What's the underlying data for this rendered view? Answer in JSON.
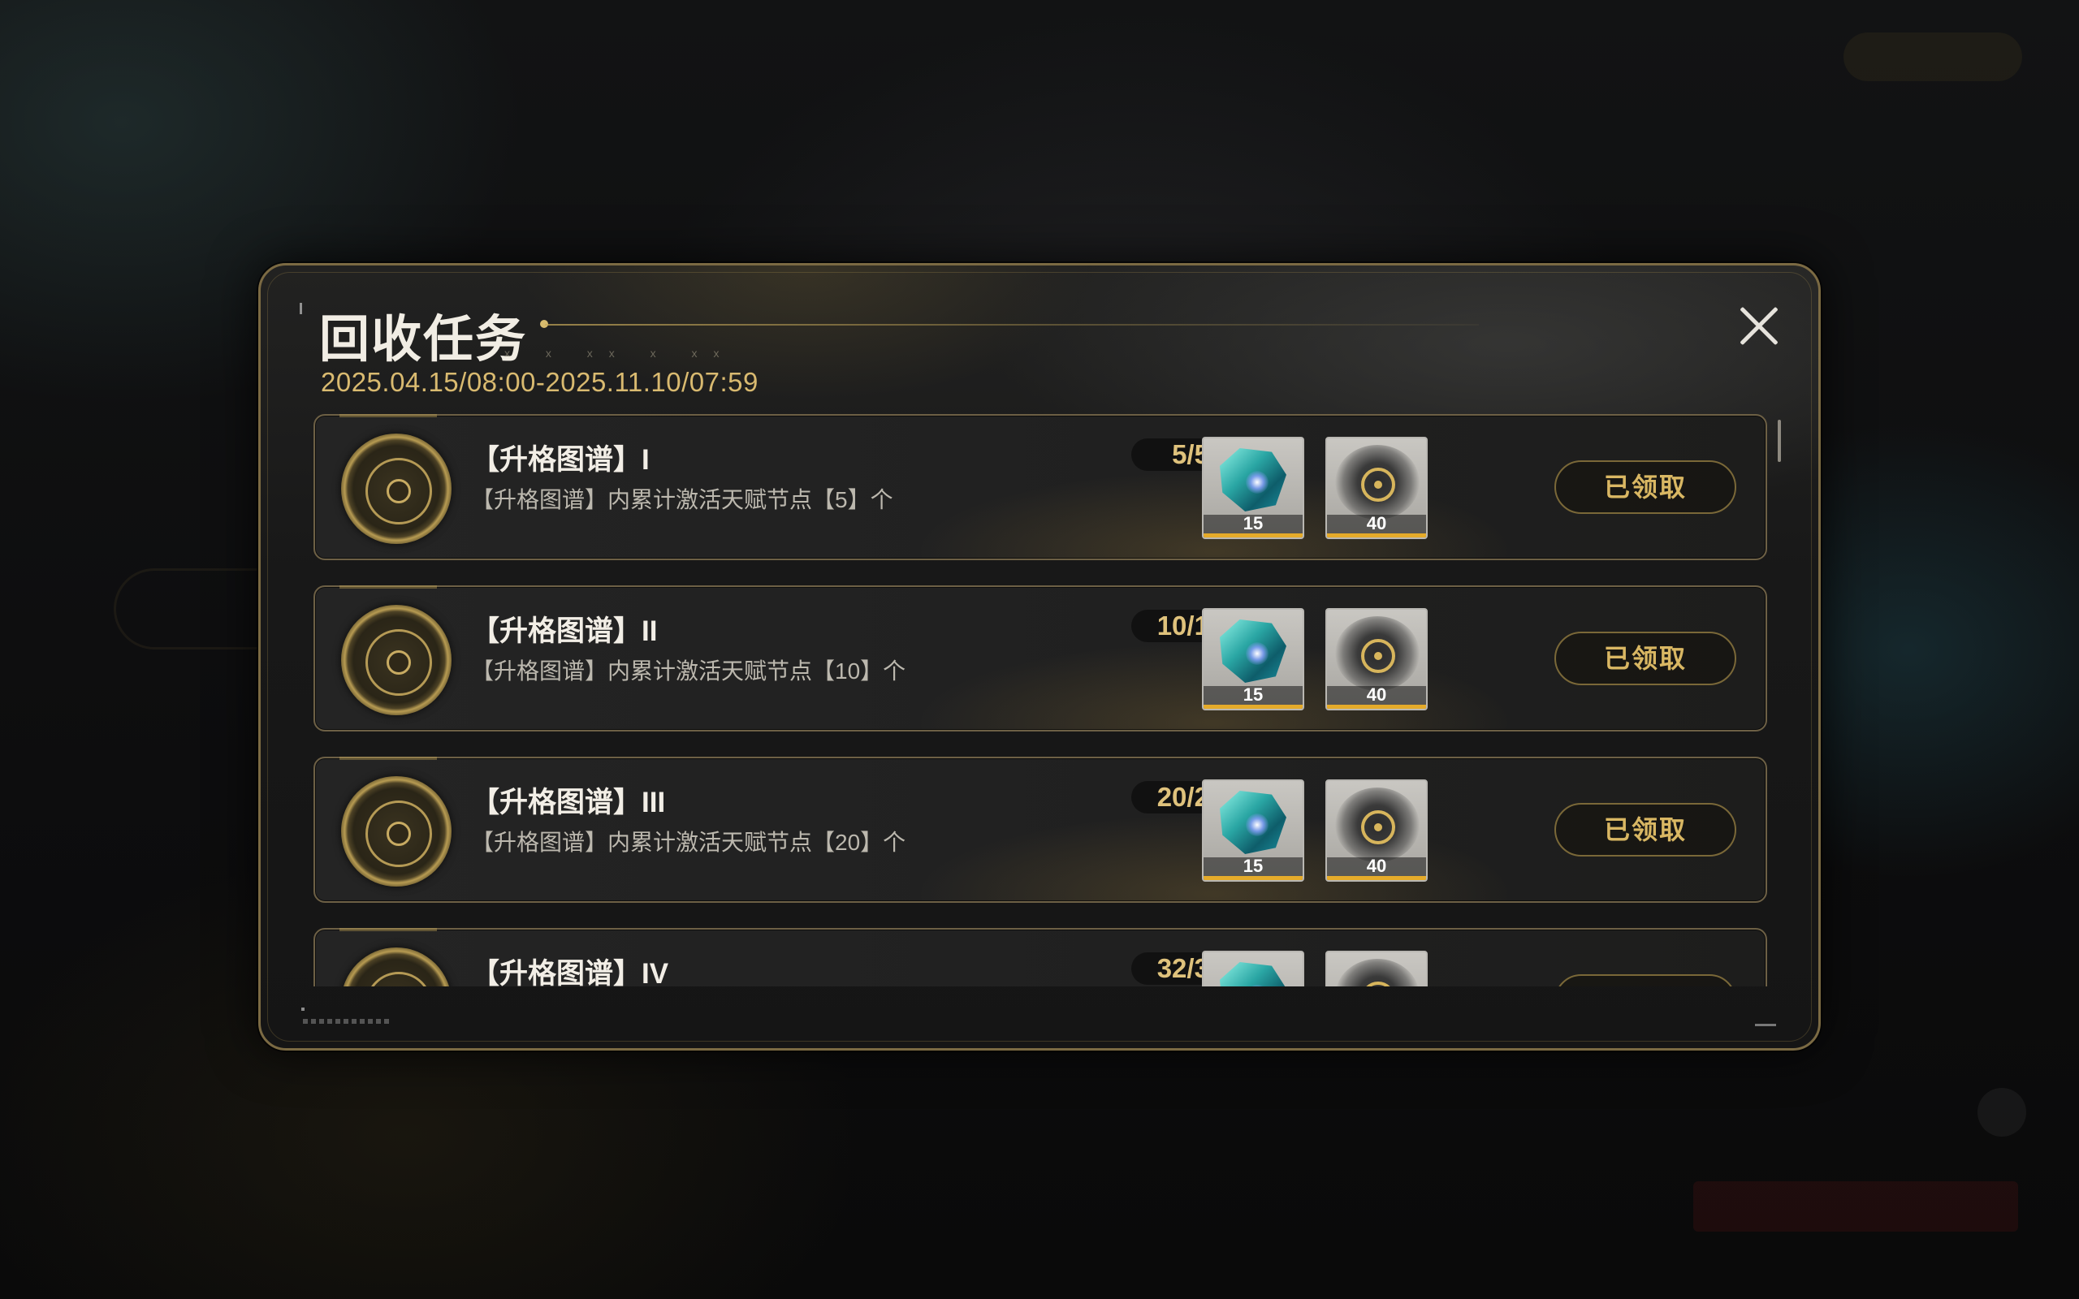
{
  "modal": {
    "title": "回收任务",
    "date_range": "2025.04.15/08:00-2025.11.10/07:59"
  },
  "icons": {
    "close": "close-icon",
    "task_emblem": "talent-chart-emblem-icon",
    "reward_1": "teal-crystal-icon",
    "reward_2": "gold-cog-icon"
  },
  "colors": {
    "accent_gold": "#d9b763",
    "progress_text": "#dfc27c",
    "quantity_bar": "#e5ab2a"
  },
  "tasks": [
    {
      "title": "【升格图谱】I",
      "description": "【升格图谱】内累计激活天赋节点【5】个",
      "progress": "5/5",
      "rewards": [
        {
          "icon": "teal-crystal-icon",
          "quantity": "15"
        },
        {
          "icon": "gold-cog-icon",
          "quantity": "40"
        }
      ],
      "status_label": "已领取"
    },
    {
      "title": "【升格图谱】II",
      "description": "【升格图谱】内累计激活天赋节点【10】个",
      "progress": "10/10",
      "rewards": [
        {
          "icon": "teal-crystal-icon",
          "quantity": "15"
        },
        {
          "icon": "gold-cog-icon",
          "quantity": "40"
        }
      ],
      "status_label": "已领取"
    },
    {
      "title": "【升格图谱】III",
      "description": "【升格图谱】内累计激活天赋节点【20】个",
      "progress": "20/20",
      "rewards": [
        {
          "icon": "teal-crystal-icon",
          "quantity": "15"
        },
        {
          "icon": "gold-cog-icon",
          "quantity": "40"
        }
      ],
      "status_label": "已领取"
    },
    {
      "title": "【升格图谱】IV",
      "description": "",
      "progress": "32/32",
      "rewards": [
        {
          "icon": "teal-crystal-icon",
          "quantity": ""
        },
        {
          "icon": "gold-cog-icon",
          "quantity": ""
        }
      ],
      "status_label": ""
    }
  ]
}
